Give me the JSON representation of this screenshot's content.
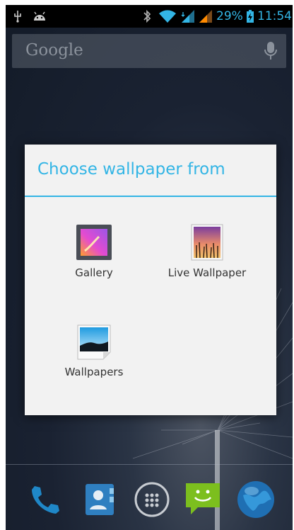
{
  "status_bar": {
    "battery_percent": "29%",
    "time": "11:54",
    "icons": [
      "usb-icon",
      "android-debug-icon",
      "bluetooth-icon",
      "wifi-icon",
      "signal-icon",
      "signal-icon",
      "battery-charging-icon"
    ],
    "accent_color": "#33b5e5"
  },
  "search": {
    "hint": "Google",
    "mic_icon": "mic-icon"
  },
  "dialog": {
    "title": "Choose wallpaper from",
    "options": [
      {
        "label": "Gallery",
        "icon": "gallery-icon"
      },
      {
        "label": "Live Wallpaper",
        "icon": "live-wallpaper-icon"
      },
      {
        "label": "Wallpapers",
        "icon": "wallpapers-icon"
      }
    ]
  },
  "dock": {
    "items": [
      {
        "name": "phone",
        "icon": "phone-icon"
      },
      {
        "name": "contacts",
        "icon": "contacts-icon"
      },
      {
        "name": "all-apps",
        "icon": "all-apps-icon"
      },
      {
        "name": "messaging",
        "icon": "messaging-icon"
      },
      {
        "name": "browser",
        "icon": "browser-icon"
      }
    ]
  }
}
